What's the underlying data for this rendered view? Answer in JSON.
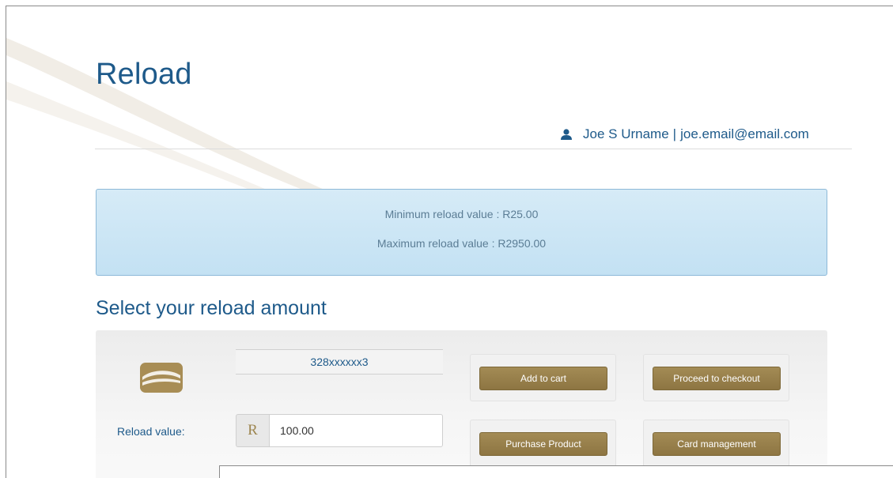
{
  "page": {
    "title": "Reload"
  },
  "user": {
    "name": "Joe S Urname",
    "separator": "|",
    "email": "joe.email@email.com",
    "icon": "user-icon"
  },
  "info": {
    "min_reload": "Minimum reload value : R25.00",
    "max_reload": "Maximum reload value : R2950.00"
  },
  "reload": {
    "section_title": "Select your reload amount",
    "card_number": "328xxxxxx3",
    "label": "Reload value:",
    "currency": "R",
    "value": "100.00"
  },
  "actions": {
    "add_to_cart": "Add to cart",
    "proceed_to_checkout": "Proceed to checkout",
    "purchase_product": "Purchase Product",
    "card_management": "Card management"
  },
  "colors": {
    "heading_blue": "#1e5a8a",
    "info_bg": "#c9e4f4",
    "button_gold": "#9a8250"
  }
}
